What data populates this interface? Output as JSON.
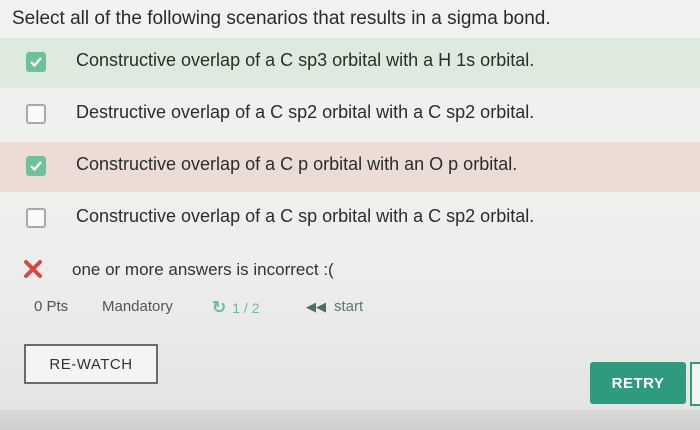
{
  "question": {
    "text": "Select all of the following scenarios that results in a sigma bond."
  },
  "options": [
    {
      "label": "Constructive overlap of a C sp3 orbital with a H 1s orbital.",
      "checked": true
    },
    {
      "label": "Destructive overlap of a C sp2 orbital with a C sp2 orbital.",
      "checked": false
    },
    {
      "label": "Constructive overlap of a C p orbital with an O p orbital.",
      "checked": true
    },
    {
      "label": "Constructive overlap of a C sp orbital with a C sp2 orbital.",
      "checked": false
    }
  ],
  "status": {
    "text": "one or more answers is incorrect :("
  },
  "meta": {
    "points": "0 Pts",
    "mandatory": "Mandatory",
    "attempts": "1 / 2",
    "start": "start"
  },
  "buttons": {
    "rewatch": "RE-WATCH",
    "retry": "RETRY"
  },
  "colors": {
    "accent": "#2f9a7f",
    "checked": "#6fc19a",
    "correct_row": "#dfeadf",
    "wrong_row": "#ecdcd6",
    "error_x": "#d94848"
  }
}
